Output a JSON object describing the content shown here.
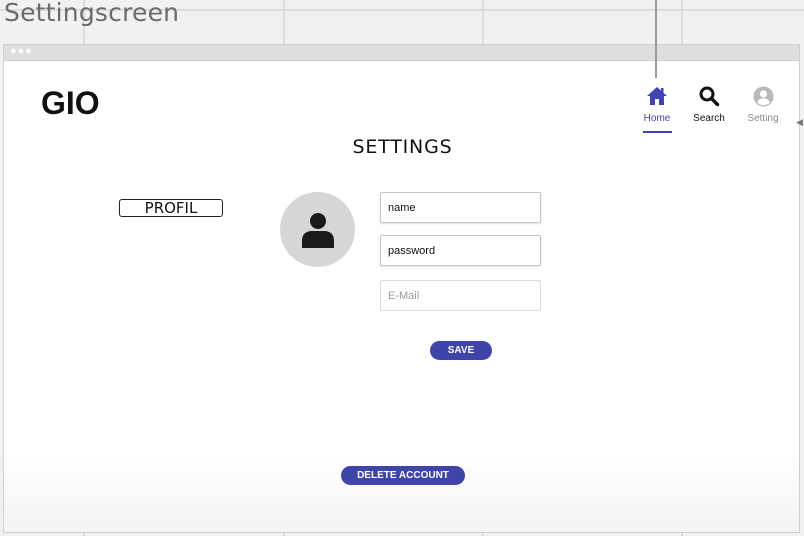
{
  "canvas": {
    "title": "Settingscreen"
  },
  "app": {
    "logo": "GIO"
  },
  "nav": [
    {
      "label": "Home",
      "icon": "home-icon",
      "active": true
    },
    {
      "label": "Search",
      "icon": "search-icon",
      "active": false
    },
    {
      "label": "Setting",
      "icon": "user-circle-icon",
      "active": false
    }
  ],
  "page": {
    "title": "SETTINGS"
  },
  "profile": {
    "label": "PROFIL",
    "avatar_icon": "person-icon"
  },
  "form": {
    "name_value": "name",
    "password_value": "password",
    "email_placeholder": "E-Mail",
    "save_label": "SAVE"
  },
  "danger": {
    "delete_label": "DELETE ACCOUNT"
  },
  "colors": {
    "accent": "#3f45a8",
    "nav_active": "#3f45b0",
    "avatar_bg": "#d6d6d6"
  }
}
